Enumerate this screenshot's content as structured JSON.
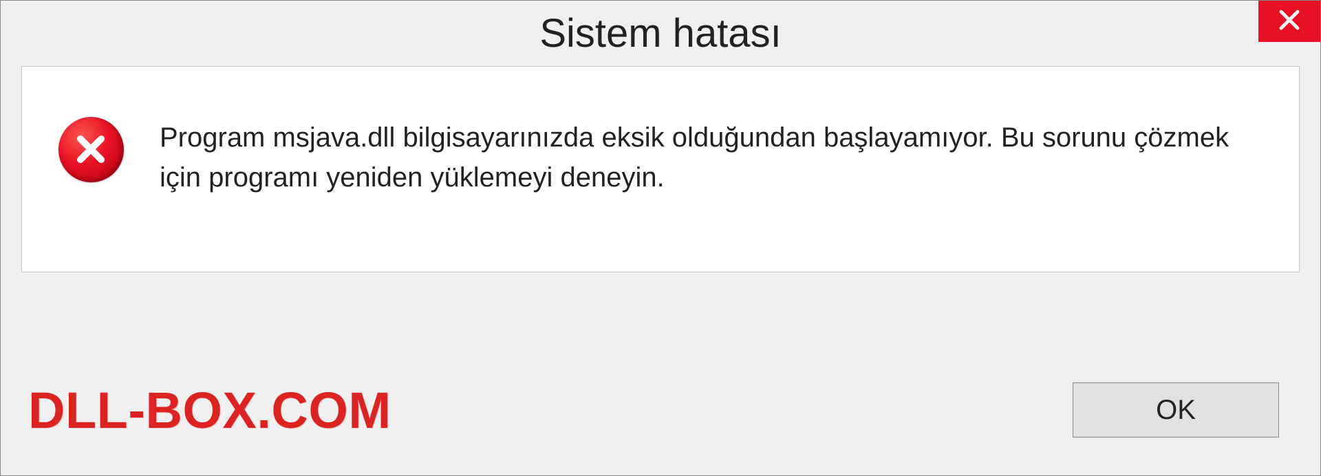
{
  "titlebar": {
    "title": "Sistem hatası"
  },
  "content": {
    "message": "Program msjava.dll bilgisayarınızda eksik olduğundan başlayamıyor. Bu sorunu çözmek için programı yeniden yüklemeyi deneyin."
  },
  "footer": {
    "watermark": "DLL-BOX.COM",
    "ok_label": "OK"
  },
  "colors": {
    "close_button_bg": "#e81123",
    "error_icon_bg": "#e81123",
    "watermark_color": "#d22"
  }
}
